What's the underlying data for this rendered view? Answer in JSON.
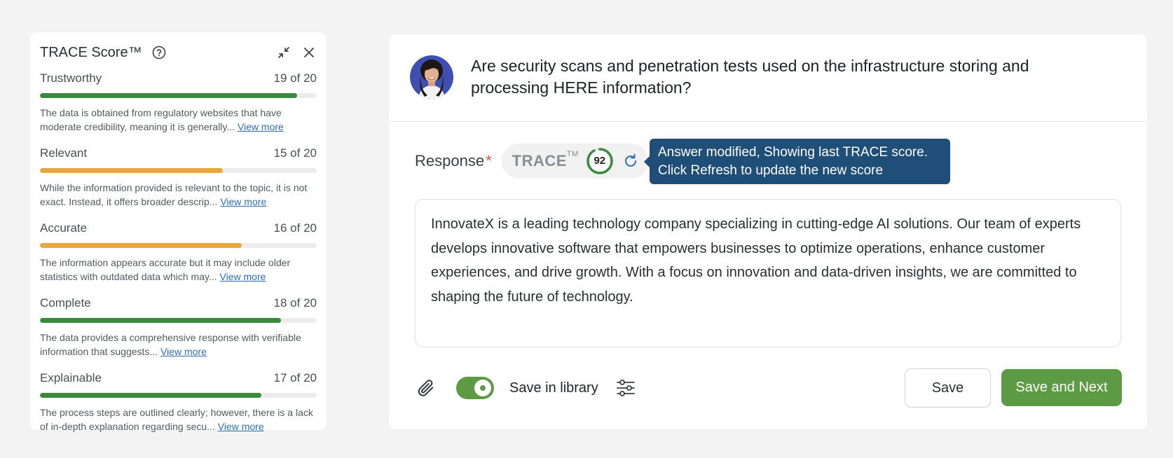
{
  "panel": {
    "title": "TRACE Score™",
    "metrics": [
      {
        "label": "Trustworthy",
        "score": "19 of 20",
        "fraction": 0.93,
        "color": "#3a8a3d",
        "description": "The data is obtained from regulatory websites that have moderate credibility, meaning it is generally...",
        "link": "View more"
      },
      {
        "label": "Relevant",
        "score": "15 of 20",
        "fraction": 0.66,
        "color": "#e9a83d",
        "description": "While the information provided is relevant to the topic, it is not exact. Instead, it offers broader descrip...",
        "link": "View more"
      },
      {
        "label": "Accurate",
        "score": "16 of 20",
        "fraction": 0.73,
        "color": "#e9a83d",
        "description": "The information appears accurate but it may include older statistics with outdated data which may...",
        "link": "View more"
      },
      {
        "label": "Complete",
        "score": "18 of 20",
        "fraction": 0.87,
        "color": "#3a8a3d",
        "description": "The data provides a comprehensive response with verifiable information that suggests...",
        "link": "View more"
      },
      {
        "label": "Explainable",
        "score": "17 of 20",
        "fraction": 0.8,
        "color": "#3a8a3d",
        "description": "The process steps are outlined clearly; however, there is a lack of in-depth explanation regarding secu...",
        "link": "View more"
      }
    ]
  },
  "question": {
    "text": "Are security scans and penetration tests used on the infrastructure storing and processing HERE information?"
  },
  "response": {
    "label": "Response",
    "required_marker": "*",
    "trace_label": "TRACE",
    "trace_tm": "TM",
    "score": "92",
    "score_fraction": 0.92,
    "score_color": "#3a8a3d",
    "tooltip_line1": "Answer modified, Showing last TRACE score.",
    "tooltip_line2": "Click Refresh to update the new score",
    "answer_text": "InnovateX is a leading technology company specializing in cutting-edge AI solutions. Our team of experts develops innovative software that empowers businesses to optimize operations, enhance customer experiences, and drive growth. With a focus on innovation and data-driven insights, we are committed to shaping the future of technology."
  },
  "footer": {
    "save_in_library_label": "Save in library",
    "save_in_library_on": true,
    "save_label": "Save",
    "save_next_label": "Save and Next"
  },
  "colors": {
    "accent_green": "#5d9a44",
    "tooltip_bg": "#1f4e79",
    "link": "#2d6fb3"
  }
}
